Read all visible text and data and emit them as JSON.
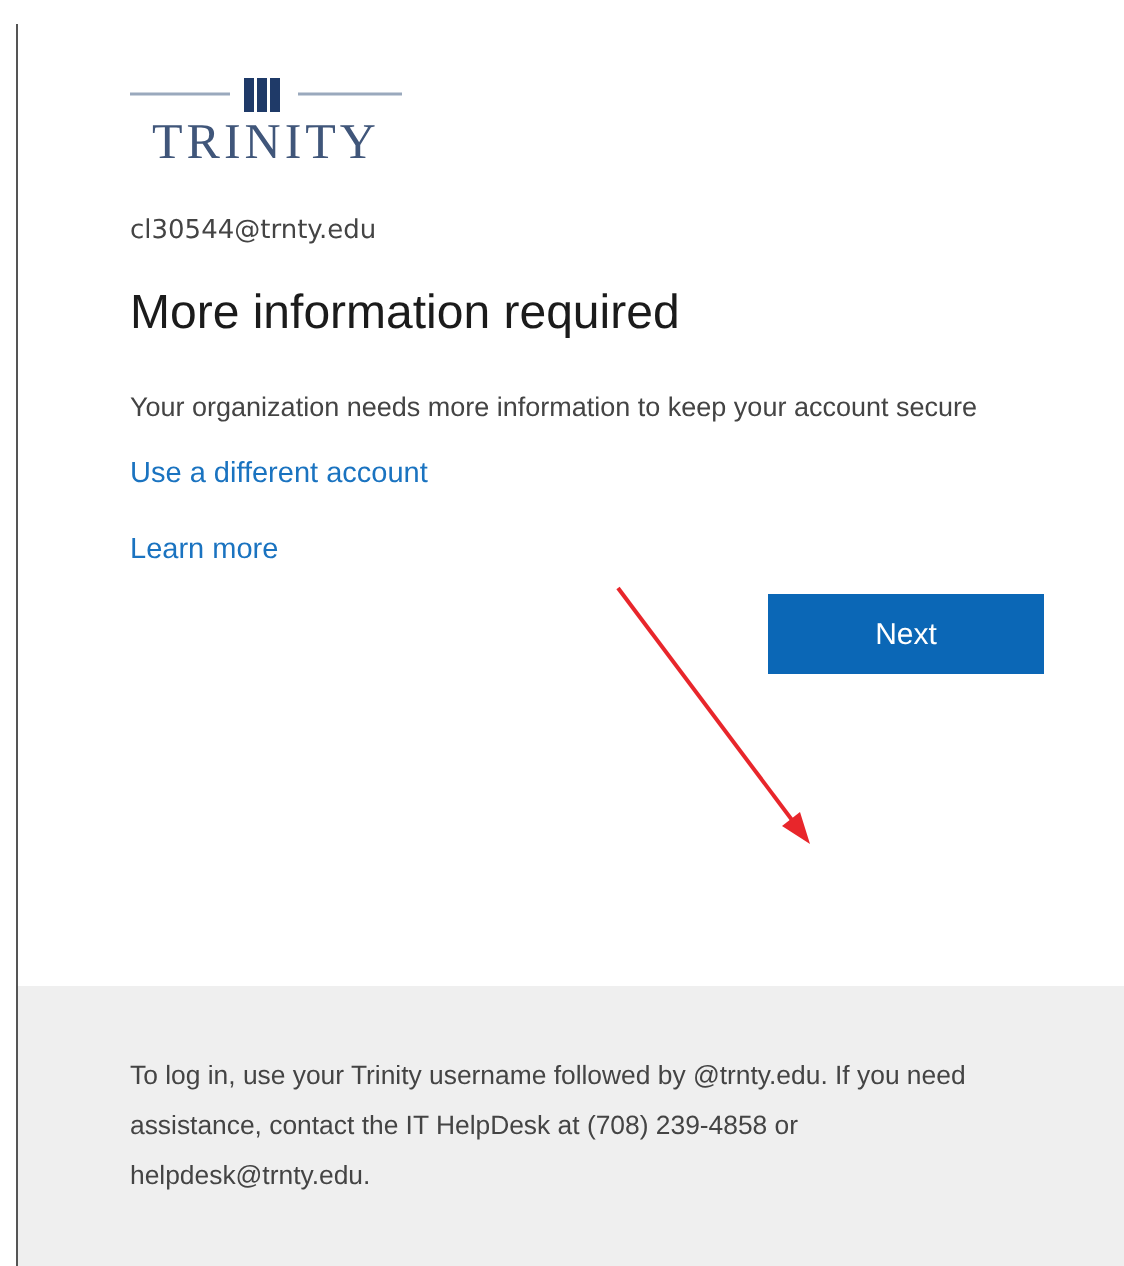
{
  "logo": {
    "text": "TRINITY"
  },
  "account": "cl30544@trnty.edu",
  "title": "More information required",
  "message": "Your organization needs more information to keep your account secure",
  "links": [
    "Use a different account",
    "Learn more"
  ],
  "button": "Next",
  "annotation": {
    "kind": "arrow"
  },
  "footer": "To log in, use your Trinity username followed by @trnty.edu. If you need assistance, contact the IT HelpDesk at (708) 239-4858 or helpdesk@trnty.edu."
}
